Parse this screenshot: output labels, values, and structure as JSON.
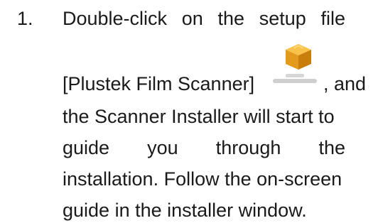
{
  "step": {
    "number": "1.",
    "line1": [
      "Double-click",
      "on",
      "the",
      "setup",
      "file"
    ],
    "line2_before_icon": "[Plustek Film Scanner]",
    "line2_after_icon": ", and",
    "line3": "the Scanner Installer will start to",
    "line4": [
      "guide",
      "you",
      "through",
      "the"
    ],
    "line5": "installation. Follow the on-screen",
    "line6": "guide in the installer window."
  },
  "icons": {
    "setup_file": "installer-package-icon"
  },
  "colors": {
    "text": "#1a1a1a",
    "box_top": "#f7b733",
    "box_side": "#d9890c",
    "caption": "#c8c8c8"
  }
}
